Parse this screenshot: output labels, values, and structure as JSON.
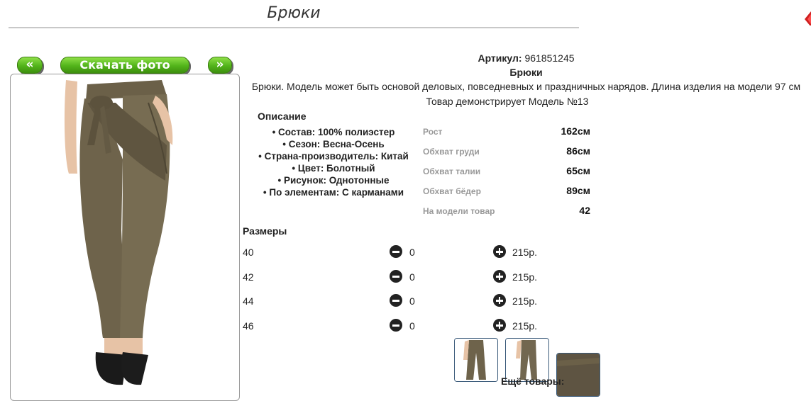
{
  "page_title": "Брюки",
  "gallery": {
    "prev_label": "«",
    "download_label": "Скачать фото",
    "next_label": "»"
  },
  "product": {
    "article_label": "Артикул:",
    "article_value": "961851245",
    "name": "Брюки",
    "description": "Брюки. Модель может быть основой деловых, повседневных и праздничных нарядов. Длина изделия на модели 97 см",
    "model_note": "Товар демонстрирует Модель №13"
  },
  "description_section": {
    "title": "Описание",
    "features": [
      "Состав: 100% полиэстер",
      "Сезон: Весна-Осень",
      "Страна-производитель: Китай",
      "Цвет: Болотный",
      "Рисунок: Однотонные",
      "По элементам: С карманами"
    ]
  },
  "model_params": [
    {
      "label": "Рост",
      "value": "162см"
    },
    {
      "label": "Обхват груди",
      "value": "86см"
    },
    {
      "label": "Обхват талии",
      "value": "65см"
    },
    {
      "label": "Обхват бёдер",
      "value": "89см"
    },
    {
      "label": "На модели товар",
      "value": "42"
    }
  ],
  "sizes_section": {
    "title": "Размеры",
    "rows": [
      {
        "size": "40",
        "qty": "0",
        "price": "215р."
      },
      {
        "size": "42",
        "qty": "0",
        "price": "215р."
      },
      {
        "size": "44",
        "qty": "0",
        "price": "215р."
      },
      {
        "size": "46",
        "qty": "0",
        "price": "215р."
      }
    ]
  },
  "more_products_label": "Ещё товары:",
  "colors": {
    "button_green": "#52b31a",
    "pants_olive": "#6b6048",
    "thumb_border": "#3a5a7a"
  },
  "icons": [
    "double-left-arrow",
    "double-right-arrow",
    "minus-circle-icon",
    "plus-circle-icon",
    "corner-ribbon-icon"
  ]
}
